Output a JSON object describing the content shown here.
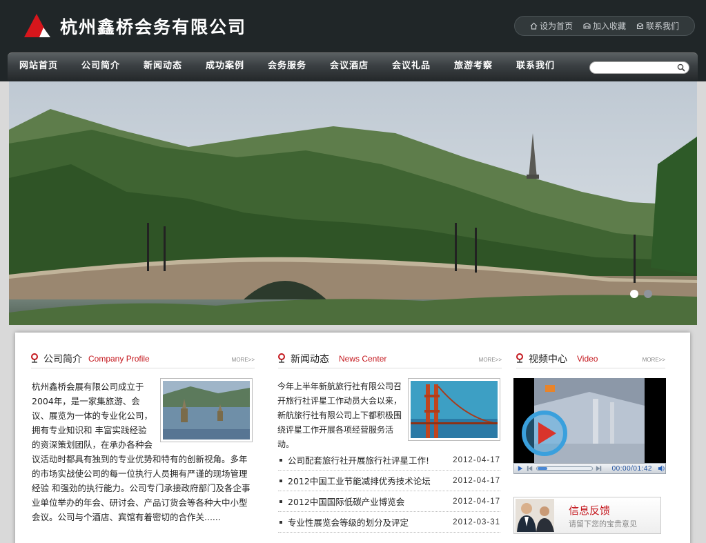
{
  "header": {
    "site_title": "杭州鑫桥会务有限公司",
    "quick_links": [
      {
        "label": "设为首页",
        "icon": "home-icon"
      },
      {
        "label": "加入收藏",
        "icon": "favorite-icon"
      },
      {
        "label": "联系我们",
        "icon": "contact-icon"
      }
    ]
  },
  "nav": {
    "items": [
      "网站首页",
      "公司简介",
      "新闻动态",
      "成功案例",
      "会务服务",
      "会议酒店",
      "会议礼品",
      "旅游考察",
      "联系我们"
    ],
    "search_placeholder": ""
  },
  "banner": {
    "active_slide": 1,
    "total_slides": 2
  },
  "about": {
    "title_cn": "公司简介",
    "title_en": "Company Profile",
    "more": "MORE>>",
    "text": "杭州鑫桥会展有限公司成立于2004年，是一家集旅游、会议、展览为一体的专业化公司，拥有专业知识和 丰富实践经验的资深策划团队，在承办各种会议活动时都具有独到的专业优势和特有的创新视角。多年的市场实战使公司的每一位执行人员拥有严谨的现场管理经验 和强劲的执行能力。公司专门承接政府部门及各企事业单位举办的年会、研讨会、产品订货会等各种大中小型会议。公司与个酒店、宾馆有着密切的合作关......"
  },
  "news": {
    "title_cn": "新闻动态",
    "title_en": "News Center",
    "more": "MORE>>",
    "lead": "今年上半年新航旅行社有限公司召开旅行社评星工作动员大会以来，新航旅行社有限公司上下都积极围绕评星工作开展各项经营服务活动。",
    "items": [
      {
        "title": "公司配套旅行社开展旅行社评星工作!",
        "date": "2012-04-17"
      },
      {
        "title": "2012中国工业节能减排优秀技术论坛",
        "date": "2012-04-17"
      },
      {
        "title": "2012中国国际低碳产业博览会",
        "date": "2012-04-17"
      },
      {
        "title": "专业性展览会等级的划分及评定",
        "date": "2012-03-31"
      }
    ]
  },
  "video": {
    "title_cn": "视频中心",
    "title_en": "Video",
    "more": "MORE>>",
    "time": "00:00/01:42"
  },
  "feedback": {
    "title": "信息反馈",
    "subtitle": "请留下您的宝贵意见"
  },
  "colors": {
    "accent_red": "#c4161c",
    "header_bg": "#202628"
  }
}
